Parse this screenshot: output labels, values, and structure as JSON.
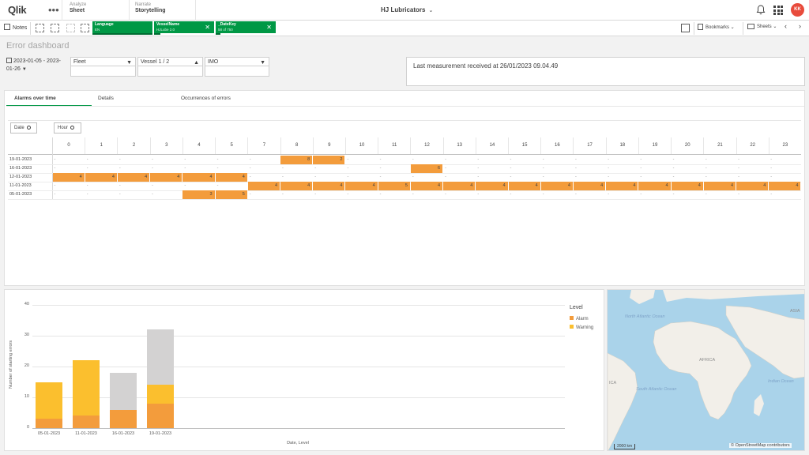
{
  "app": {
    "logo": "Qlik",
    "title": "HJ Lubricators",
    "avatar": "KK",
    "nav": [
      {
        "small": "Analyze",
        "big": "Sheet"
      },
      {
        "small": "Narrate",
        "big": "Storytelling"
      }
    ]
  },
  "toolbar": {
    "notes": "Notes",
    "bookmarks": "Bookmarks",
    "sheets": "Sheets",
    "chips": [
      {
        "name": "Language",
        "value": "EN",
        "fill": 1.0
      },
      {
        "name": "VesselName",
        "value": "HJLube 2.0",
        "fill": 0.1
      },
      {
        "name": "_DateKey",
        "value": "58 of 750",
        "fill": 0.08
      }
    ]
  },
  "sheet": {
    "title": "Error dashboard",
    "date_filter": "2023-01-05 - 2023-01-26",
    "filters": [
      {
        "label": "Fleet",
        "arrow": "▼"
      },
      {
        "label": "Vessel 1 / 2",
        "arrow": "▲"
      },
      {
        "label": "IMO",
        "arrow": "▼"
      }
    ],
    "last_measurement": "Last measurement received at 26/01/2023 09.04.49"
  },
  "tabs": [
    "Alarms over time",
    "Details",
    "Occurrences of errors"
  ],
  "pivot": {
    "row_dim": "Date",
    "col_dim": "Hour",
    "hours": [
      "0",
      "1",
      "2",
      "3",
      "4",
      "5",
      "7",
      "8",
      "9",
      "10",
      "11",
      "12",
      "13",
      "14",
      "15",
      "16",
      "17",
      "18",
      "19",
      "20",
      "21",
      "22",
      "23"
    ],
    "rows": [
      {
        "date": "19-01-2023",
        "cells": [
          "-",
          "-",
          "-",
          "-",
          "-",
          "-",
          "-",
          "8",
          "2",
          "-",
          "-",
          "-",
          "-",
          "-",
          "-",
          "-",
          "-",
          "-",
          "-",
          "-",
          "-",
          "-",
          "-"
        ]
      },
      {
        "date": "16-01-2023",
        "cells": [
          "-",
          "-",
          "-",
          "-",
          "-",
          "-",
          "-",
          "-",
          "-",
          "-",
          "-",
          "6",
          "-",
          "-",
          "-",
          "-",
          "-",
          "-",
          "-",
          "-",
          "-",
          "-",
          "-"
        ]
      },
      {
        "date": "12-01-2023",
        "cells": [
          "4",
          "4",
          "4",
          "4",
          "4",
          "4",
          "-",
          "-",
          "-",
          "-",
          "-",
          "-",
          "-",
          "-",
          "-",
          "-",
          "-",
          "-",
          "-",
          "-",
          "-",
          "-",
          "-"
        ]
      },
      {
        "date": "11-01-2023",
        "cells": [
          "-",
          "-",
          "-",
          "-",
          "-",
          "-",
          "4",
          "4",
          "4",
          "4",
          "5",
          "4",
          "4",
          "4",
          "4",
          "4",
          "4",
          "4",
          "4",
          "4",
          "4",
          "4",
          "4"
        ]
      },
      {
        "date": "05-01-2023",
        "cells": [
          "-",
          "-",
          "-",
          "-",
          "3",
          "5",
          "-",
          "-",
          "-",
          "-",
          "-",
          "-",
          "-",
          "-",
          "-",
          "-",
          "-",
          "-",
          "-",
          "-",
          "-",
          "-",
          "-"
        ]
      }
    ]
  },
  "chart_data": {
    "type": "bar",
    "stacked": true,
    "categories": [
      "05-01-2023",
      "11-01-2023",
      "16-01-2023",
      "19-01-2023"
    ],
    "series": [
      {
        "name": "Alarm",
        "color": "#f39c3c",
        "values": [
          3,
          4,
          6,
          8
        ]
      },
      {
        "name": "Warning",
        "color": "#fbbf2e",
        "values": [
          12,
          18,
          0,
          6
        ]
      },
      {
        "name": "",
        "color": "#d3d2d2",
        "values": [
          0,
          0,
          12,
          18
        ]
      }
    ],
    "xlabel": "Date, Level",
    "ylabel": "Number of starting errors",
    "ylim": [
      0,
      40
    ],
    "yticks": [
      0,
      10,
      20,
      30,
      40
    ],
    "legend_title": "Level",
    "legend_position": "right",
    "grid": true
  },
  "map": {
    "labels": [
      "North Atlantic Ocean",
      "AFRICA",
      "ASIA",
      "South Atlantic Ocean",
      "Indian Ocean",
      "ICA"
    ],
    "scale": "2000 km",
    "attribution": "© OpenStreetMap contributors",
    "colors": {
      "water": "#aad3ea",
      "land": "#f2efe9"
    }
  }
}
